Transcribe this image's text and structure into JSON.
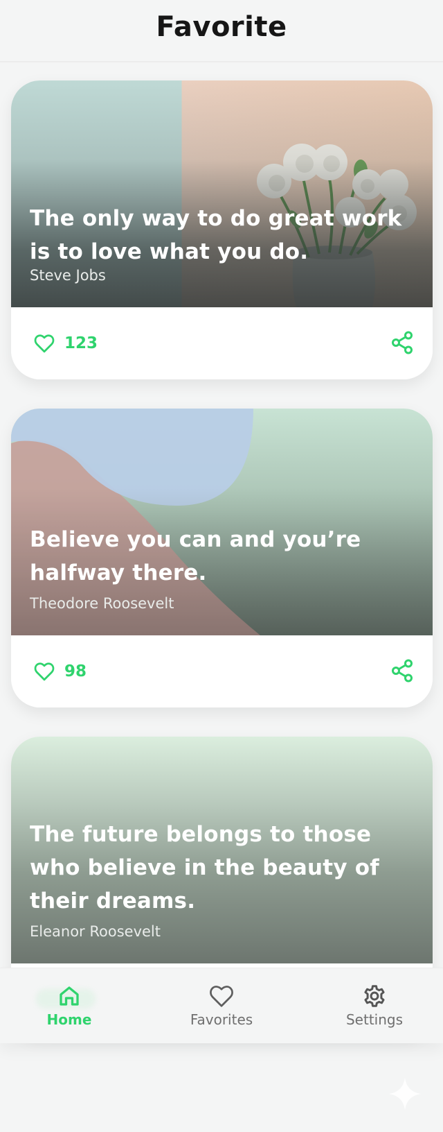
{
  "header": {
    "title": "Favorite"
  },
  "colors": {
    "accent": "#2fd36d",
    "background": "#f4f5f5",
    "card": "#ffffff"
  },
  "cards": [
    {
      "quote": "The only way to do great work is to love what you do.",
      "author": "Steve Jobs",
      "likes": "123",
      "like_icon": "heart-outline-icon",
      "share_icon": "share-icon"
    },
    {
      "quote": "Believe you can and you’re halfway there.",
      "author": "Theodore Roosevelt",
      "likes": "98",
      "like_icon": "heart-outline-icon",
      "share_icon": "share-icon"
    },
    {
      "quote": "The future belongs to those who believe in the beauty of their dreams.",
      "author": "Eleanor Roosevelt"
    }
  ],
  "bottom_nav": {
    "items": [
      {
        "label": "Home",
        "icon": "home-icon",
        "active": true
      },
      {
        "label": "Favorites",
        "icon": "heart-outline-icon",
        "active": false
      },
      {
        "label": "Settings",
        "icon": "gear-icon",
        "active": false
      }
    ]
  }
}
